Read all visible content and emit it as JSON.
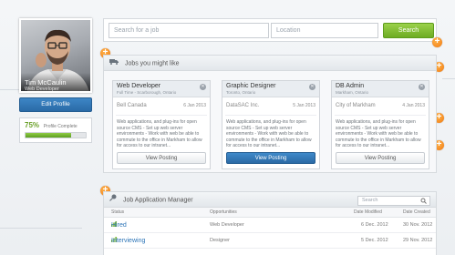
{
  "profile": {
    "name": "Tim McCaulin",
    "role": "Web Developer",
    "edit_label": "Edit Profile",
    "complete_percent": "75%",
    "complete_label": "Profile Complete",
    "complete_value": 0.75
  },
  "search": {
    "job_placeholder": "Search for a job",
    "location_placeholder": "Location",
    "button_label": "Search"
  },
  "jobs_section": {
    "title": "Jobs you might like",
    "jobs": [
      {
        "title": "Web Developer",
        "subtitle": "Full Time - Scarborough, Ontario",
        "company": "Bell Canada",
        "date": "6 Jan 2013",
        "description": "Web applications, and plug-ins for open source CMS - Set up web server environments - Work with web be able to commute to the office in Markham to allow for access to our intranet...",
        "button": "View Posting"
      },
      {
        "title": "Graphic Designer",
        "subtitle": "Toronto, Ontario",
        "company": "DataSAC Inc.",
        "date": "5 Jan 2013",
        "description": "Web applications, and plug-ins for open source CMS - Set up web server environments - Work with web be able to commute to the office in Markham to allow for access to our intranet...",
        "button": "View Posting"
      },
      {
        "title": "DB Admin",
        "subtitle": "Markham, Ontario",
        "company": "City of Markham",
        "date": "4 Jan 2013",
        "description": "Web applications, and plug-ins for open source CMS - Set up web server environments - Work with web be able to commute to the office in Markham to allow for access to our intranet...",
        "button": "View Posting"
      }
    ]
  },
  "manager": {
    "title": "Job Application Manager",
    "search_placeholder": "Search",
    "columns": [
      "Status",
      "Opportunities",
      "Date Modified",
      "Date Created"
    ],
    "rows": [
      {
        "status": "Hired",
        "opportunity": "Web Developer",
        "modified": "6 Dec. 2012",
        "created": "30 Nov. 2012"
      },
      {
        "status": "Interviewing",
        "opportunity": "Designer",
        "modified": "5 Dec. 2012",
        "created": "29 Nov. 2012"
      }
    ]
  },
  "colors": {
    "accent_blue": "#2f74b5",
    "accent_green": "#7ab832",
    "add_orange": "#f3861b"
  }
}
